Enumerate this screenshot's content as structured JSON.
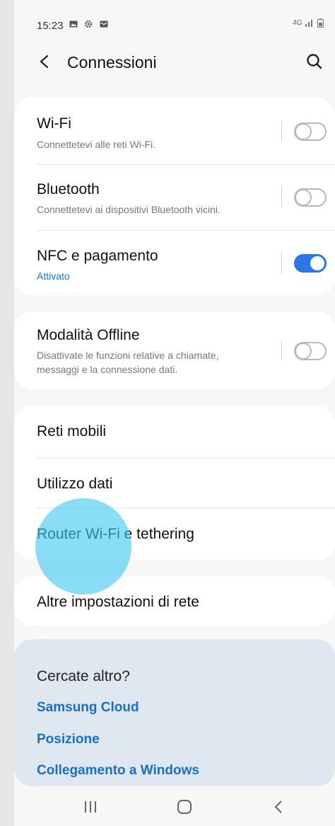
{
  "status_bar": {
    "time": "15:23",
    "left_icons": [
      "gallery-icon",
      "settings-icon",
      "message-icon"
    ],
    "right_text": "4G"
  },
  "header": {
    "title": "Connessioni"
  },
  "group1": [
    {
      "title": "Wi-Fi",
      "subtitle": "Connettetevi alle reti Wi-Fi.",
      "toggle": false
    },
    {
      "title": "Bluetooth",
      "subtitle": "Connettetevi ai dispositivi Bluetooth vicini.",
      "toggle": false
    },
    {
      "title": "NFC e pagamento",
      "subtitle": "Attivato",
      "toggle": true
    }
  ],
  "group2": [
    {
      "title": "Modalità Offline",
      "subtitle_line1": "Disattivate le funzioni relative a chiamate,",
      "subtitle_line2": "messaggi e la connessione dati.",
      "toggle": false
    }
  ],
  "group3": [
    {
      "title": "Reti mobili"
    },
    {
      "title": "Utilizzo dati"
    },
    {
      "title": "Router Wi-Fi e tethering"
    }
  ],
  "group4": [
    {
      "title": "Altre impostazioni di rete"
    }
  ],
  "search_more": {
    "title": "Cercate altro?",
    "links": [
      "Samsung Cloud",
      "Posizione",
      "Collegamento a Windows"
    ]
  },
  "colors": {
    "accent": "#2b78e4",
    "link": "#1a6fc4",
    "subtitle_on": "#1a73c8"
  }
}
